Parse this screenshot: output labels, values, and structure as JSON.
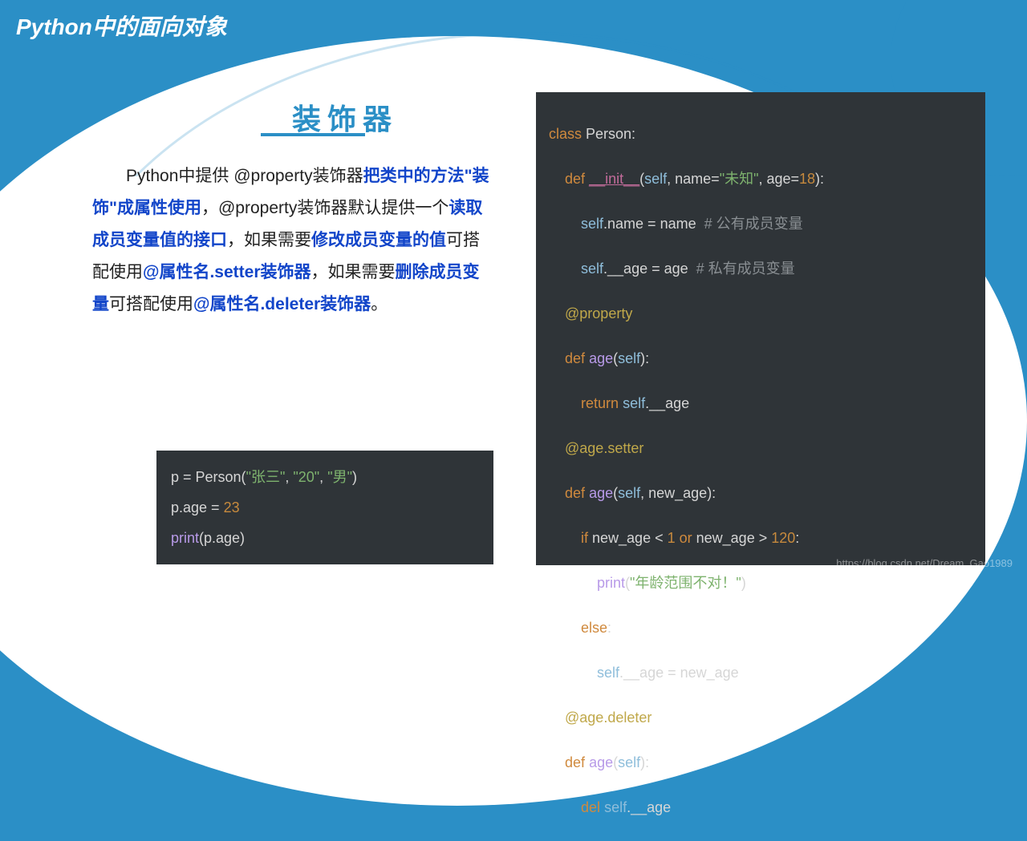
{
  "slide_title": "Python中的面向对象",
  "sub_heading": "装饰器",
  "paragraph": {
    "p1": "Python中提供  @property装饰器",
    "hl1": "把类中的方法\"装饰\"成属性使用",
    "p2": "，@property装饰器默认提供一个",
    "hl2": "读取成员变量值的接口",
    "p3": "，如果需要",
    "hl3": "修改成员变量的值",
    "p4": "可搭配使用",
    "hl4": "@属性名.setter装饰器",
    "p5": "，如果需要",
    "hl5": "删除成员变量",
    "p6": "可搭配使用",
    "hl6": "@属性名.deleter装饰器",
    "p7": "。"
  },
  "left_code": {
    "l1_a": "p = Person(",
    "l1_b": "\"张三\"",
    "l1_c": ", ",
    "l1_d": "\"20\"",
    "l1_e": ", ",
    "l1_f": "\"男\"",
    "l1_g": ")",
    "l2_a": "p.age = ",
    "l2_b": "23",
    "l3_a": "print",
    "l3_b": "(p.age)"
  },
  "right_code": {
    "l1_a": "class",
    "l1_b": " Person:",
    "l2_a": "def",
    "l2_b": " ",
    "l2_c": "__init__",
    "l2_d": "(",
    "l2_e": "self",
    "l2_f": ", name=",
    "l2_g": "\"未知\"",
    "l2_h": ", age=",
    "l2_i": "18",
    "l2_j": "):",
    "l3_a": "self",
    "l3_b": ".name = name  ",
    "l3_c": "# 公有成员变量",
    "l4_a": "self",
    "l4_b": ".__age = age  ",
    "l4_c": "# 私有成员变量",
    "l5": "@property",
    "l6_a": "def",
    "l6_b": " ",
    "l6_c": "age",
    "l6_d": "(",
    "l6_e": "self",
    "l6_f": "):",
    "l7_a": "return",
    "l7_b": " ",
    "l7_c": "self",
    "l7_d": ".__age",
    "l8": "@age.setter",
    "l9_a": "def",
    "l9_b": " ",
    "l9_c": "age",
    "l9_d": "(",
    "l9_e": "self",
    "l9_f": ", new_age):",
    "l10_a": "if",
    "l10_b": " new_age < ",
    "l10_c": "1",
    "l10_d": " ",
    "l10_e": "or",
    "l10_f": " new_age > ",
    "l10_g": "120",
    "l10_h": ":",
    "l11_a": "print",
    "l11_b": "(",
    "l11_c": "\"年龄范围不对！\"",
    "l11_d": ")",
    "l12_a": "else",
    "l12_b": ":",
    "l13_a": "self",
    "l13_b": ".__age = new_age",
    "l14": "@age.deleter",
    "l15_a": "def",
    "l15_b": " ",
    "l15_c": "age",
    "l15_d": "(",
    "l15_e": "self",
    "l15_f": "):",
    "l16_a": "del",
    "l16_b": " ",
    "l16_c": "self",
    "l16_d": ".__age"
  },
  "watermark": "https://blog.csdn.net/Dream_Gao1989"
}
